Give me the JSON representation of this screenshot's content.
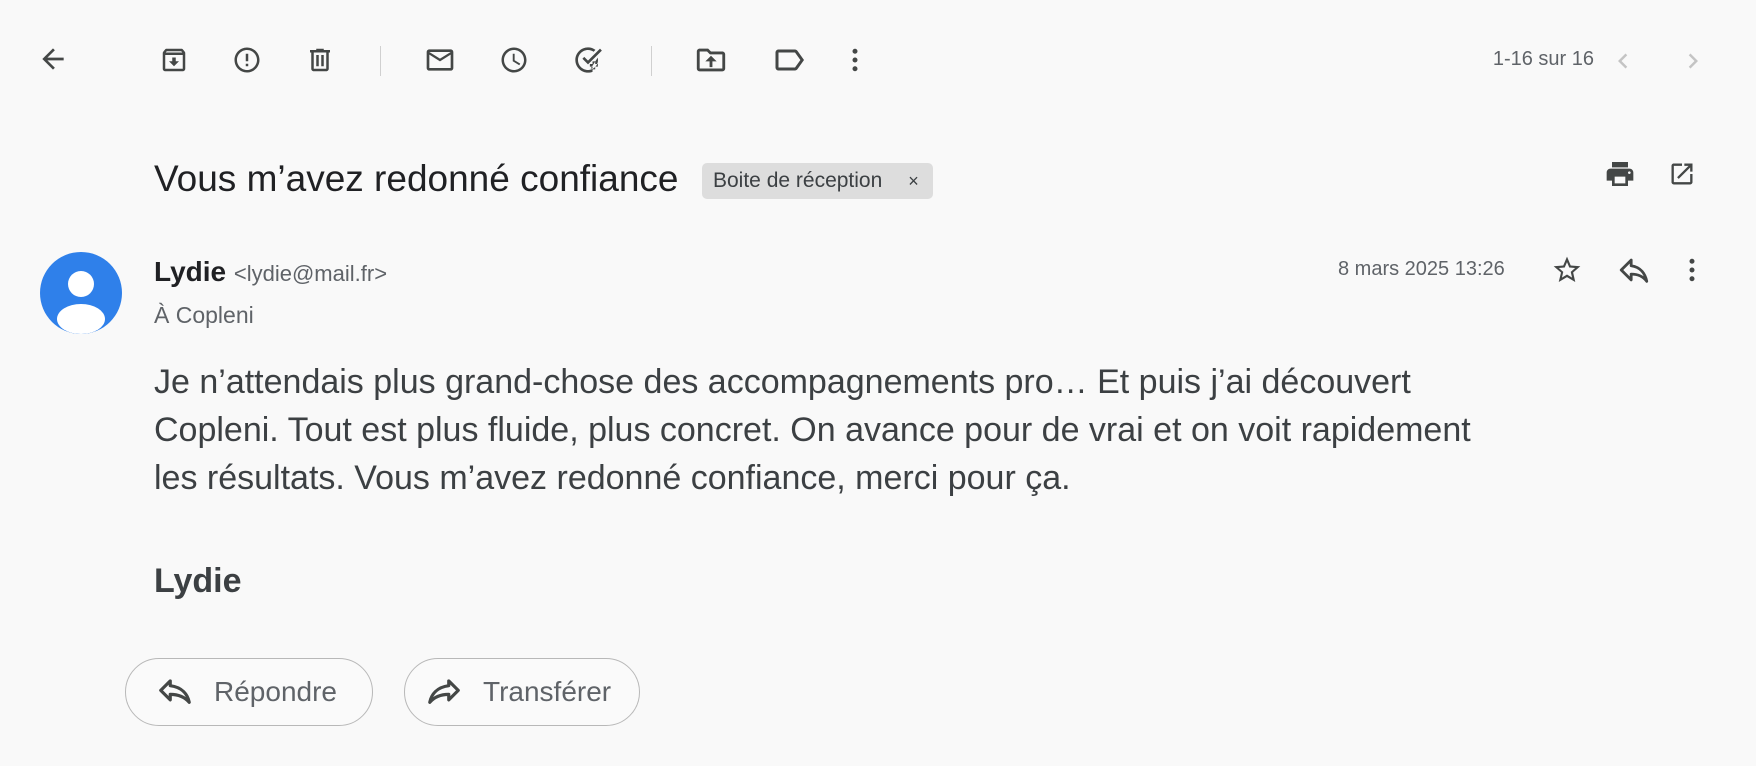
{
  "toolbar": {
    "pagination": "1-16 sur 16"
  },
  "email": {
    "subject": "Vous m’avez redonné confiance",
    "label": "Boite de réception",
    "label_remove": "×",
    "sender_name": "Lydie",
    "sender_email": "<lydie@mail.fr>",
    "recipient": "À Copleni",
    "date": "8 mars 2025 13:26",
    "body": "Je n’attendais plus grand-chose des accompagnements pro… Et puis j’ai découvert Copleni. Tout est plus fluide, plus concret. On avance pour de vrai et on voit rapidement les résultats. Vous m’avez redonné confiance, merci pour ça.",
    "signature": "Lydie"
  },
  "actions": {
    "reply_label": "Répondre",
    "forward_label": "Transférer"
  },
  "colors": {
    "avatar": "#2f80ea",
    "background": "#f9f9f9",
    "icon": "#444746"
  }
}
